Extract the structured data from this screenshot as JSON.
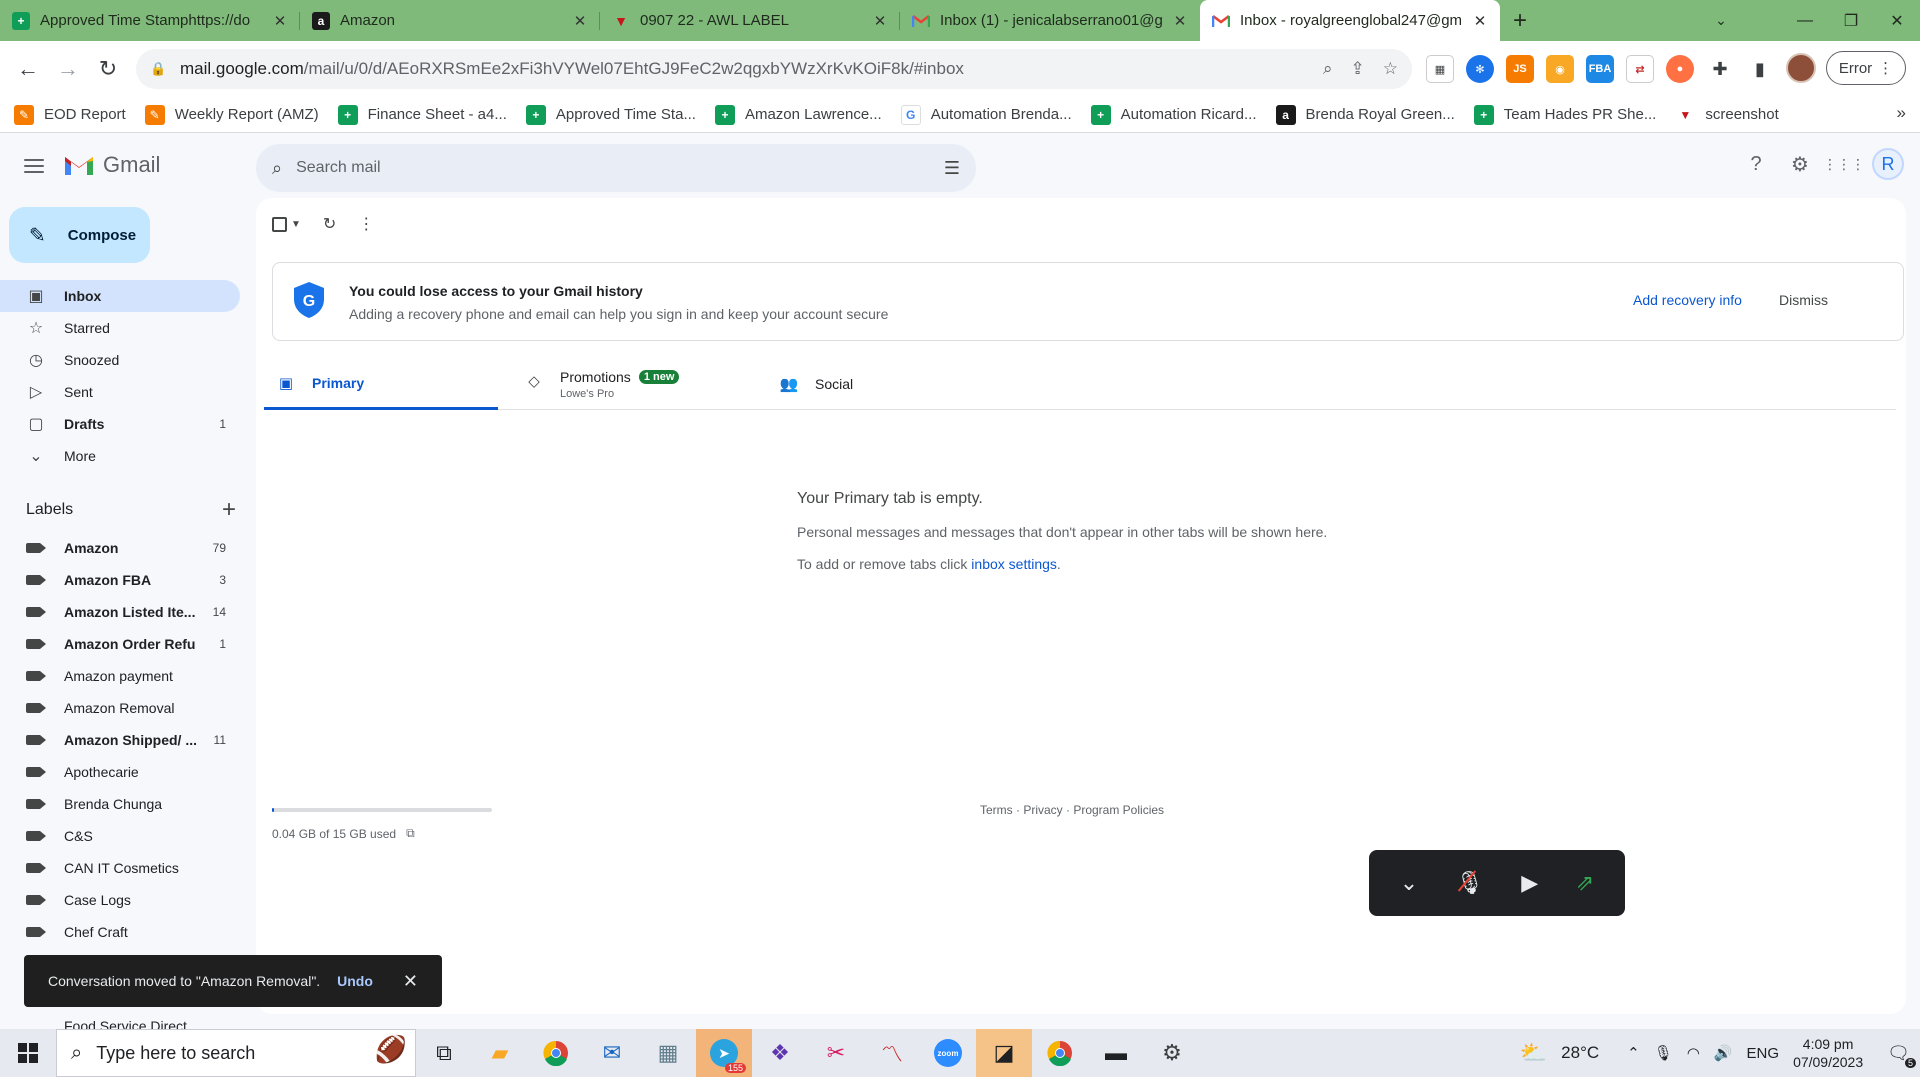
{
  "browser": {
    "tabs": [
      {
        "title": "Approved Time Stamphttps://do",
        "favicon": "sheets-icon",
        "active": false
      },
      {
        "title": "Amazon",
        "favicon": "amazon-icon",
        "active": false
      },
      {
        "title": "0907 22 - AWL LABEL",
        "favicon": "awl-icon",
        "active": false
      },
      {
        "title": "Inbox (1) - jenicalabserrano01@g",
        "favicon": "gmail-icon",
        "active": false
      },
      {
        "title": "Inbox - royalgreenglobal247@gm",
        "favicon": "gmail-icon",
        "active": true
      }
    ],
    "address": {
      "host": "mail.google.com",
      "path": "/mail/u/0/d/AEoRXRSmEe2xFi3hVYWel07EhtGJ9FeC2w2qgxbYWzXrKvKOiF8k/#inbox"
    },
    "profile_button_label": "Error",
    "bookmarks": [
      {
        "label": "EOD Report",
        "icon": "pen-icon"
      },
      {
        "label": "Weekly Report (AMZ)",
        "icon": "pen-icon"
      },
      {
        "label": "Finance Sheet - a4...",
        "icon": "sheets-icon"
      },
      {
        "label": "Approved Time Sta...",
        "icon": "sheets-icon"
      },
      {
        "label": "Amazon Lawrence...",
        "icon": "sheets-icon"
      },
      {
        "label": "Automation Brenda...",
        "icon": "google-icon"
      },
      {
        "label": "Automation Ricard...",
        "icon": "sheets-icon"
      },
      {
        "label": "Brenda Royal Green...",
        "icon": "amazon-icon"
      },
      {
        "label": "Team Hades PR She...",
        "icon": "sheets-icon"
      },
      {
        "label": "screenshot",
        "icon": "awl-icon"
      }
    ],
    "colors": {
      "frame": "#7fba7b",
      "accent": "#0b57d0"
    }
  },
  "gmail": {
    "product_name": "Gmail",
    "search_placeholder": "Search mail",
    "account_initial": "R",
    "compose_label": "Compose",
    "nav": [
      {
        "label": "Inbox",
        "icon": "inbox-icon",
        "count": "",
        "bold": true,
        "selected": true
      },
      {
        "label": "Starred",
        "icon": "star-icon",
        "count": "",
        "bold": false,
        "selected": false
      },
      {
        "label": "Snoozed",
        "icon": "clock-icon",
        "count": "",
        "bold": false,
        "selected": false
      },
      {
        "label": "Sent",
        "icon": "send-icon",
        "count": "",
        "bold": false,
        "selected": false
      },
      {
        "label": "Drafts",
        "icon": "draft-icon",
        "count": "1",
        "bold": true,
        "selected": false
      },
      {
        "label": "More",
        "icon": "chevron-down-icon",
        "count": "",
        "bold": false,
        "selected": false
      }
    ],
    "labels_heading": "Labels",
    "labels": [
      {
        "label": "Amazon",
        "count": "79",
        "bold": true
      },
      {
        "label": "Amazon FBA",
        "count": "3",
        "bold": true
      },
      {
        "label": "Amazon Listed Ite...",
        "count": "14",
        "bold": true
      },
      {
        "label": "Amazon Order Refu...",
        "count": "1",
        "bold": true
      },
      {
        "label": "Amazon payment",
        "count": "",
        "bold": false
      },
      {
        "label": "Amazon Removal",
        "count": "",
        "bold": false
      },
      {
        "label": "Amazon Shipped/ ...",
        "count": "11",
        "bold": true
      },
      {
        "label": "Apothecarie",
        "count": "",
        "bold": false
      },
      {
        "label": "Brenda Chunga",
        "count": "",
        "bold": false
      },
      {
        "label": "C&S",
        "count": "",
        "bold": false
      },
      {
        "label": "CAN IT Cosmetics",
        "count": "",
        "bold": false
      },
      {
        "label": "Case Logs",
        "count": "",
        "bold": false
      },
      {
        "label": "Chef Craft",
        "count": "",
        "bold": false
      }
    ],
    "partial_label": "Food Service Direct",
    "banner": {
      "title": "You could lose access to your Gmail history",
      "subtitle": "Adding a recovery phone and email can help you sign in and keep your account secure",
      "action": "Add recovery info",
      "dismiss": "Dismiss"
    },
    "tabs": [
      {
        "label": "Primary",
        "icon": "inbox-icon",
        "active": true,
        "badge": "",
        "sub": ""
      },
      {
        "label": "Promotions",
        "icon": "tag-icon",
        "active": false,
        "badge": "1 new",
        "sub": "Lowe's Pro"
      },
      {
        "label": "Social",
        "icon": "people-icon",
        "active": false,
        "badge": "",
        "sub": ""
      }
    ],
    "empty": {
      "title": "Your Primary tab is empty.",
      "line1": "Personal messages and messages that don't appear in other tabs will be shown here.",
      "line2_prefix": "To add or remove tabs click ",
      "line2_link": "inbox settings",
      "line2_suffix": "."
    },
    "storage": {
      "used_text": "0.04 GB of 15 GB used",
      "fraction": 0.003
    },
    "footer": "Terms · Privacy · Program Policies",
    "toast": {
      "message": "Conversation moved to \"Amazon Removal\".",
      "action": "Undo"
    }
  },
  "taskbar": {
    "search_placeholder": "Type here to search",
    "weather": "28°C",
    "language": "ENG",
    "time": "4:09 pm",
    "date": "07/09/2023",
    "telegram_badge": "155",
    "notification_count": "5"
  }
}
